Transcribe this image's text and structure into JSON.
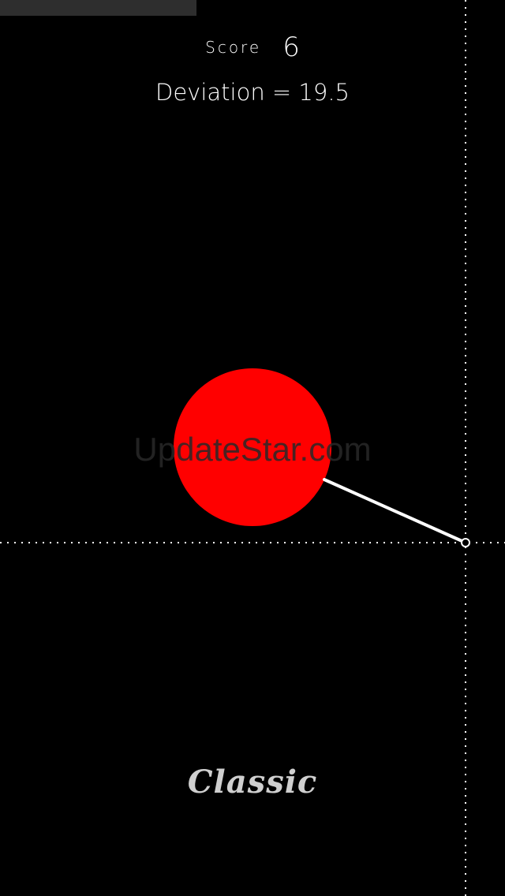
{
  "hud": {
    "score_label": "Score",
    "score_value": "6",
    "deviation_text": "Deviation = 19.5"
  },
  "game": {
    "ball_color": "#ff0000",
    "line_color": "#ffffff",
    "guide_color": "#ffffff",
    "background": "#000000"
  },
  "watermark": "UpdateStar.com",
  "mode": {
    "label": "Classic"
  }
}
